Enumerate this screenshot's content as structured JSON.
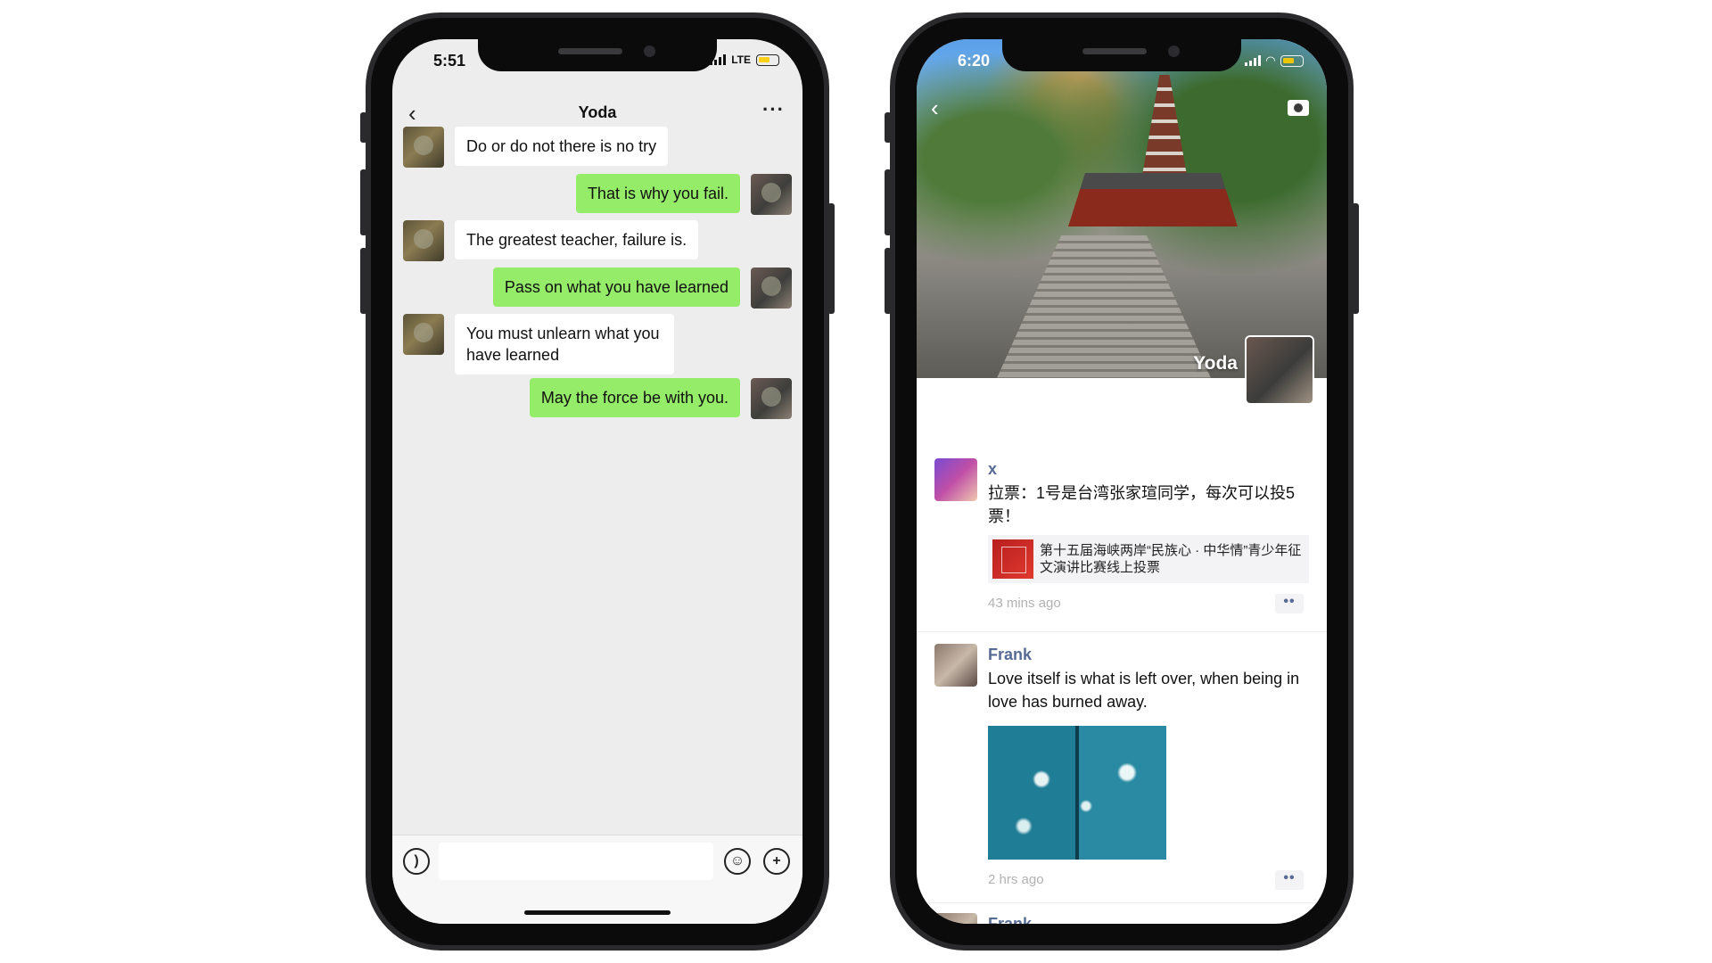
{
  "chat_phone": {
    "status": {
      "time": "5:51",
      "network": "LTE"
    },
    "header": {
      "title": "Yoda",
      "back_icon": "chevron-left-icon",
      "more_icon": "ellipsis-icon"
    },
    "messages": [
      {
        "direction": "incoming",
        "text": "Do or do not there is no try"
      },
      {
        "direction": "outgoing",
        "text": "That is why you fail."
      },
      {
        "direction": "incoming",
        "text": "The greatest teacher, failure is."
      },
      {
        "direction": "outgoing",
        "text": "Pass on what you have learned"
      },
      {
        "direction": "incoming",
        "text": "You must unlearn what you have learned"
      },
      {
        "direction": "outgoing",
        "text": "May the force be with you."
      }
    ],
    "input_bar": {
      "voice_icon": "voice-icon",
      "input_value": "",
      "emoji_icon": "emoji-icon",
      "plus_icon": "plus-icon"
    }
  },
  "moments_phone": {
    "status": {
      "time": "6:20"
    },
    "cover": {
      "name": "Yoda",
      "camera_icon": "camera-icon",
      "back_icon": "chevron-left-icon"
    },
    "posts": [
      {
        "author": "x",
        "text": "拉票：1号是台湾张家瑄同学，每次可以投5票！",
        "link_title": "第十五届海峡两岸“民族心 · 中华情”青少年征文演讲比赛线上投票",
        "time": "43 mins ago",
        "more": "••"
      },
      {
        "author": "Frank",
        "text": "Love itself is what is left over, when being in love has burned away.",
        "time": "2 hrs ago",
        "more": "••"
      },
      {
        "author": "Frank"
      }
    ]
  },
  "colors": {
    "outgoing_bubble": "#95ec69",
    "incoming_bubble": "#ffffff",
    "chat_background": "#ededed",
    "author_name": "#576b95",
    "timestamp": "#b2b2b2"
  }
}
